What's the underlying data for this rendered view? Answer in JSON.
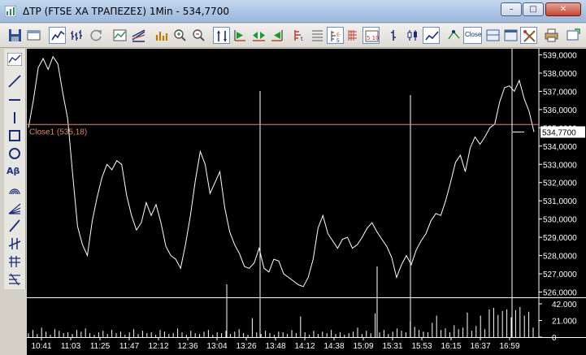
{
  "window": {
    "title": "ΔΤΡ (FTSE ΧΑ ΤΡΑΠΕΖΕΣ) 1Min - 534,7700",
    "min_label": "–",
    "max_label": "□",
    "close_label": "✕"
  },
  "toolbar": {
    "close_button_label": "Close"
  },
  "left_tools": {
    "text_tool_label": "Aβ"
  },
  "chart": {
    "close_label": "Close1 (535,18)",
    "last_value": "534,7700",
    "colors": {
      "background": "#000000",
      "line": "#ffffff",
      "close_line": "#e58970",
      "grid": "#ffffff"
    }
  },
  "chart_data": {
    "type": "line",
    "price_axis": {
      "ylim": [
        526.0,
        539.0
      ],
      "tick_labels": [
        "539,0000",
        "538,0000",
        "537,0000",
        "536,0000",
        "535,0000",
        "534,0000",
        "533,0000",
        "532,0000",
        "531,0000",
        "530,0000",
        "529,0000",
        "528,0000",
        "527,0000",
        "526,0000"
      ],
      "tick_values": [
        539,
        538,
        537,
        536,
        535,
        534,
        533,
        532,
        531,
        530,
        529,
        528,
        527,
        526
      ]
    },
    "volume_axis": {
      "ylim": [
        0,
        42
      ],
      "tick_labels": [
        "42.000",
        "21.000",
        "0"
      ],
      "tick_values": [
        42,
        21,
        0
      ]
    },
    "x_tick_labels": [
      "10:41",
      "11:03",
      "11:25",
      "11:47",
      "12:12",
      "12:36",
      "13:04",
      "13:26",
      "13:48",
      "14:12",
      "14:38",
      "15:09",
      "15:31",
      "15:53",
      "16:15",
      "16:37",
      "16:59"
    ],
    "close_reference": 535.18,
    "last_price": 534.77,
    "price_series": [
      535.0,
      536.5,
      538.3,
      538.8,
      538.2,
      538.9,
      538.5,
      536.9,
      535.5,
      532.5,
      529.6,
      528.6,
      528.0,
      529.9,
      531.2,
      532.3,
      533.0,
      532.7,
      533.2,
      533.0,
      531.3,
      530.2,
      529.4,
      529.8,
      530.9,
      530.2,
      530.8,
      529.8,
      528.5,
      528.0,
      527.8,
      527.3,
      528.6,
      530.2,
      532.1,
      533.7,
      533.0,
      531.4,
      532.0,
      532.6,
      530.6,
      529.3,
      528.6,
      528.1,
      527.4,
      527.3,
      527.6,
      528.4,
      527.3,
      527.1,
      527.8,
      527.7,
      527.0,
      526.8,
      526.6,
      526.4,
      526.3,
      526.8,
      527.8,
      529.5,
      530.2,
      529.2,
      528.8,
      528.4,
      528.9,
      529.0,
      528.4,
      528.6,
      529.0,
      529.5,
      529.8,
      529.3,
      528.9,
      528.5,
      527.9,
      526.8,
      527.5,
      528.0,
      527.5,
      528.3,
      528.8,
      529.2,
      529.9,
      530.3,
      530.2,
      531.0,
      532.0,
      533.1,
      533.5,
      532.6,
      533.9,
      534.5,
      534.1,
      534.5,
      535.0,
      535.2,
      536.4,
      537.2,
      537.3,
      537.0,
      537.6,
      536.6,
      535.9,
      534.77
    ],
    "volume_series": [
      5,
      9,
      4,
      12,
      7,
      3,
      10,
      8,
      5,
      6,
      4,
      9,
      7,
      11,
      5,
      3,
      6,
      8,
      4,
      9,
      5,
      7,
      3,
      6,
      10,
      4,
      8,
      5,
      6,
      3,
      9,
      7,
      4,
      5,
      11,
      6,
      3,
      8,
      5,
      4,
      7,
      9,
      3,
      6,
      5,
      8,
      4,
      7,
      10,
      5,
      3,
      24,
      6,
      4,
      8,
      5,
      3,
      7,
      6,
      4,
      9,
      5,
      26,
      6,
      3,
      8,
      4,
      7,
      5,
      9,
      4,
      6,
      3,
      5,
      7,
      12,
      4,
      8,
      5,
      30,
      6,
      9,
      4,
      7,
      11,
      8,
      6,
      20,
      13,
      9,
      7,
      6,
      18,
      27,
      9,
      11,
      6,
      15,
      10,
      12,
      31,
      8,
      14,
      27,
      10,
      35,
      37,
      28,
      33,
      35,
      25,
      34,
      38,
      27,
      32,
      12
    ],
    "grid": true
  }
}
